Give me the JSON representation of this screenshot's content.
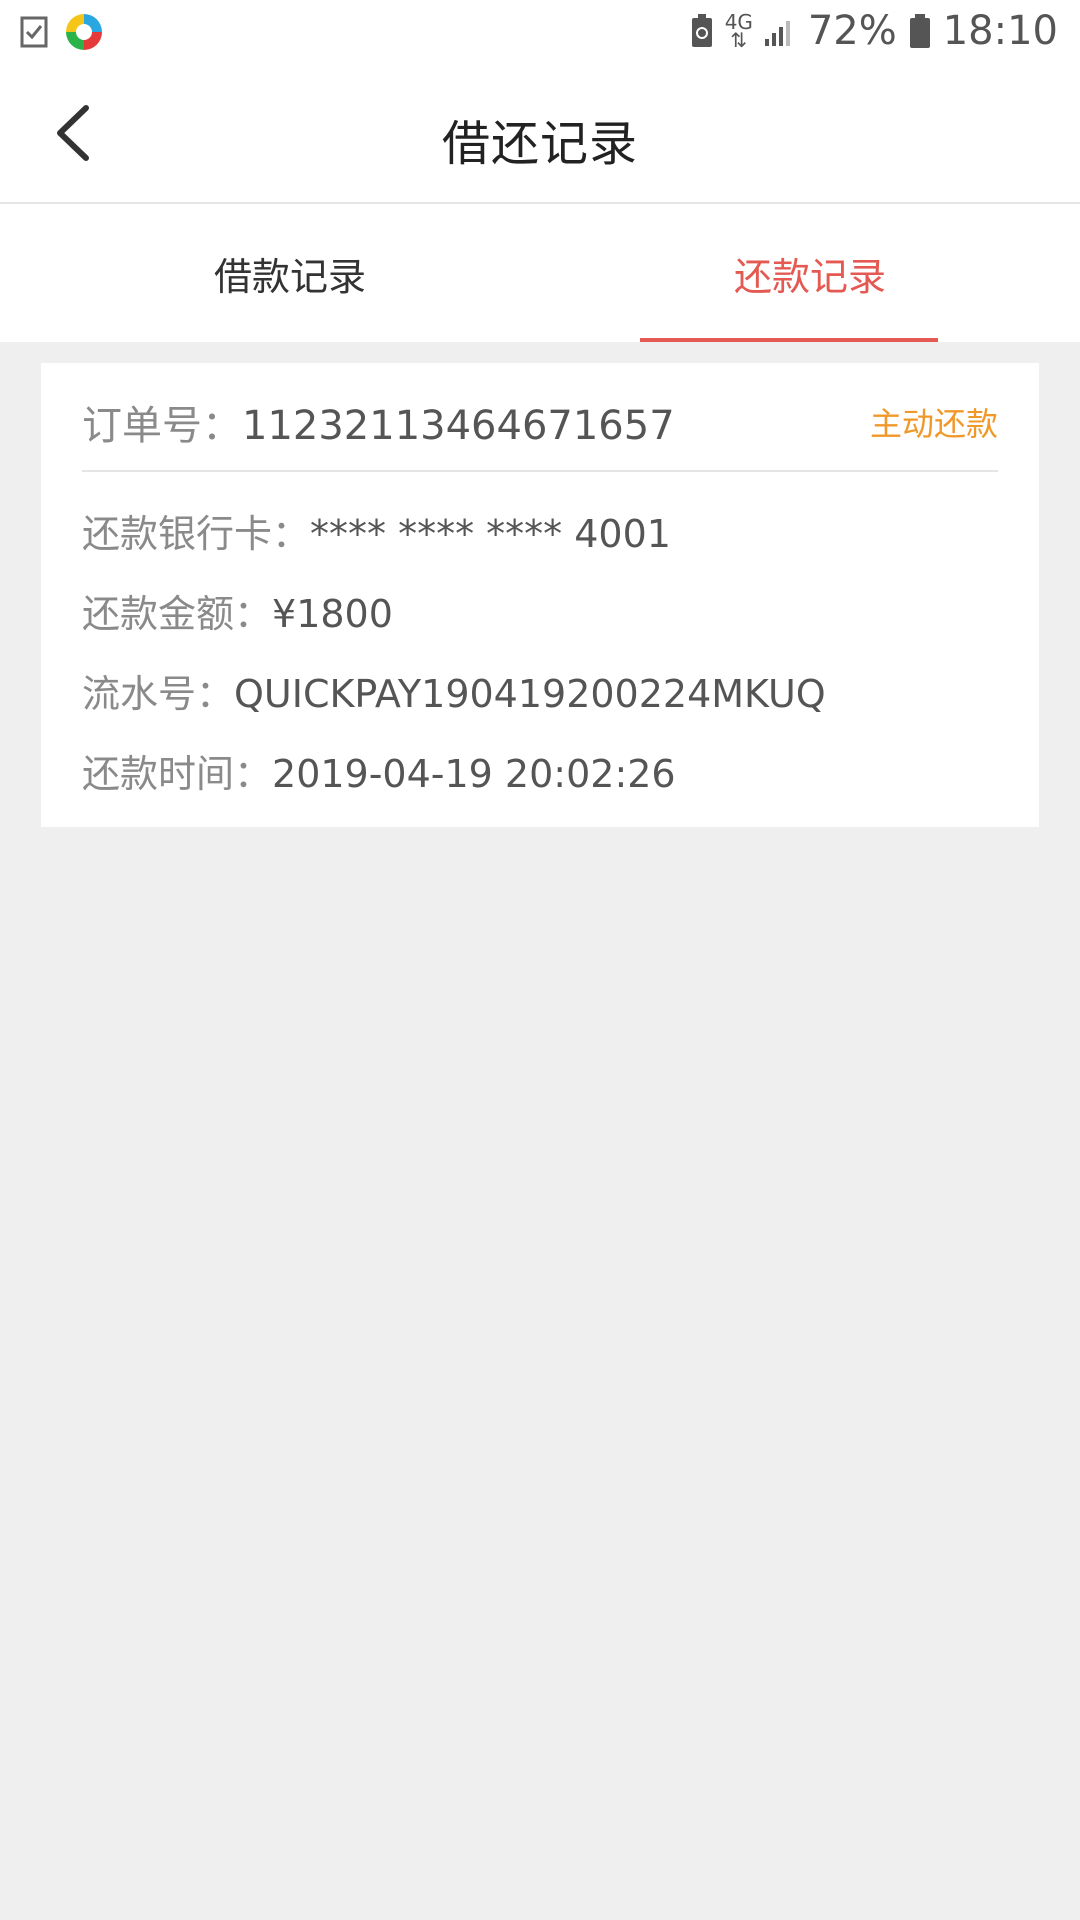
{
  "status_bar": {
    "network": "4G",
    "battery_percent": "72%",
    "time": "18:10",
    "icons": [
      "checklist-icon",
      "app-logo-icon",
      "battery-saver-icon",
      "signal-icon",
      "battery-icon"
    ]
  },
  "header": {
    "title": "借还记录",
    "back_icon": "chevron-left-icon"
  },
  "tabs": [
    {
      "label": "借款记录",
      "active": false
    },
    {
      "label": "还款记录",
      "active": true
    }
  ],
  "colors": {
    "accent_red": "#e45a53",
    "action_orange": "#f0992a",
    "background": "#efefef"
  },
  "record": {
    "order_label": "订单号：",
    "order_value": "11232113464671657",
    "action_label": "主动还款",
    "bank_card_label": "还款银行卡：",
    "bank_card_value": "**** **** **** 4001",
    "amount_label": "还款金额：",
    "amount_value": "¥1800",
    "serial_label": "流水号：",
    "serial_value": "QUICKPAY190419200224MKUQ",
    "time_label": "还款时间：",
    "time_value": "2019-04-19 20:02:26"
  }
}
